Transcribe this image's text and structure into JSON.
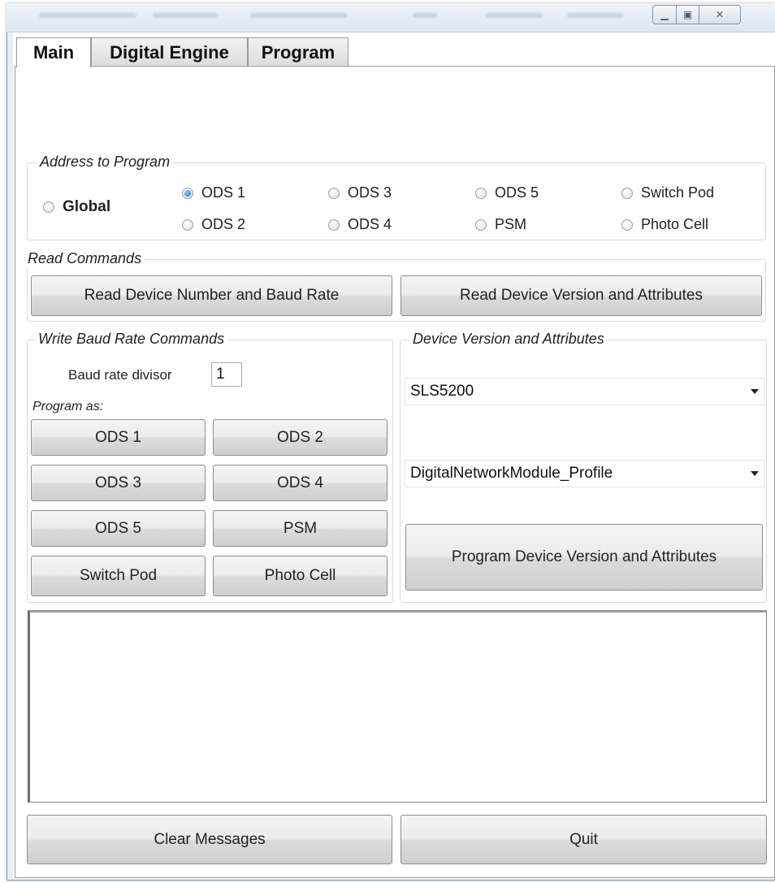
{
  "tabs": [
    "Main",
    "Digital Engine",
    "Program"
  ],
  "address_group": {
    "legend": "Address to Program",
    "global_label": "Global",
    "options": [
      {
        "label": "ODS 1",
        "selected": true
      },
      {
        "label": "ODS 3",
        "selected": false
      },
      {
        "label": "ODS 5",
        "selected": false
      },
      {
        "label": "Switch Pod",
        "selected": false
      },
      {
        "label": "ODS 2",
        "selected": false
      },
      {
        "label": "ODS 4",
        "selected": false
      },
      {
        "label": "PSM",
        "selected": false
      },
      {
        "label": "Photo Cell",
        "selected": false
      }
    ]
  },
  "read_group": {
    "legend": "Read Commands",
    "read_number_baud": "Read Device Number and Baud Rate",
    "read_version_attr": "Read Device Version and Attributes"
  },
  "write_group": {
    "legend": "Write Baud Rate Commands",
    "baud_label": "Baud rate divisor",
    "baud_value": "1",
    "program_as": "Program as:",
    "buttons": [
      "ODS 1",
      "ODS 2",
      "ODS 3",
      "ODS 4",
      "ODS 5",
      "PSM",
      "Switch Pod",
      "Photo Cell"
    ]
  },
  "device_group": {
    "legend": "Device Version and Attributes",
    "version_select": "SLS5200",
    "profile_select": "DigitalNetworkModule_Profile",
    "program_button": "Program Device Version and Attributes"
  },
  "messages": "",
  "footer": {
    "clear": "Clear Messages",
    "quit": "Quit"
  },
  "window_buttons": {
    "minimize_glyph": "▁",
    "maximize_glyph": "▣",
    "close_glyph": "✕"
  }
}
